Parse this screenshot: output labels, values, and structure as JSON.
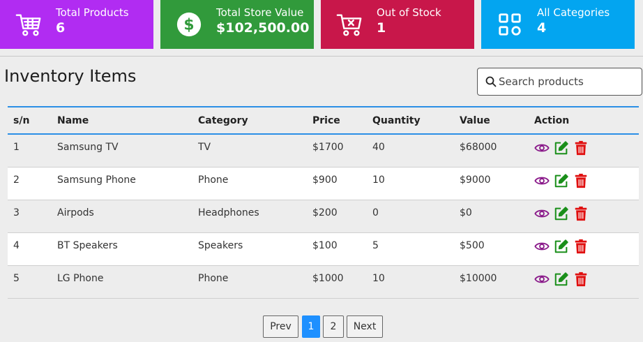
{
  "summary_cards": [
    {
      "label": "Total Products",
      "value": "6",
      "icon": "cart-icon",
      "color": "#b12cf2"
    },
    {
      "label": "Total Store Value",
      "value": "$102,500.00",
      "icon": "dollar-icon",
      "color": "#319a3b"
    },
    {
      "label": "Out of Stock",
      "value": "1",
      "icon": "cart-x-icon",
      "color": "#c8174a"
    },
    {
      "label": "All Categories",
      "value": "4",
      "icon": "categories-icon",
      "color": "#03a5f0"
    }
  ],
  "inventory": {
    "title": "Inventory Items",
    "search_placeholder": "Search products",
    "columns": [
      "s/n",
      "Name",
      "Category",
      "Price",
      "Quantity",
      "Value",
      "Action"
    ],
    "rows": [
      {
        "sn": "1",
        "name": "Samsung TV",
        "category": "TV",
        "price": "$1700",
        "quantity": "40",
        "value": "$68000"
      },
      {
        "sn": "2",
        "name": "Samsung Phone",
        "category": "Phone",
        "price": "$900",
        "quantity": "10",
        "value": "$9000"
      },
      {
        "sn": "3",
        "name": "Airpods",
        "category": "Headphones",
        "price": "$200",
        "quantity": "0",
        "value": "$0"
      },
      {
        "sn": "4",
        "name": "BT Speakers",
        "category": "Speakers",
        "price": "$100",
        "quantity": "5",
        "value": "$500"
      },
      {
        "sn": "5",
        "name": "LG Phone",
        "category": "Phone",
        "price": "$1000",
        "quantity": "10",
        "value": "$10000"
      }
    ],
    "action_icons": [
      "eye-icon",
      "edit-icon",
      "trash-icon"
    ]
  },
  "pagination": {
    "prev_label": "Prev",
    "pages": [
      "1",
      "2"
    ],
    "active_page": "1",
    "next_label": "Next"
  },
  "colors": {
    "accent": "#2b8fe6",
    "view": "#8a1a8a",
    "edit": "#1a8f1a",
    "delete": "#e01010"
  }
}
